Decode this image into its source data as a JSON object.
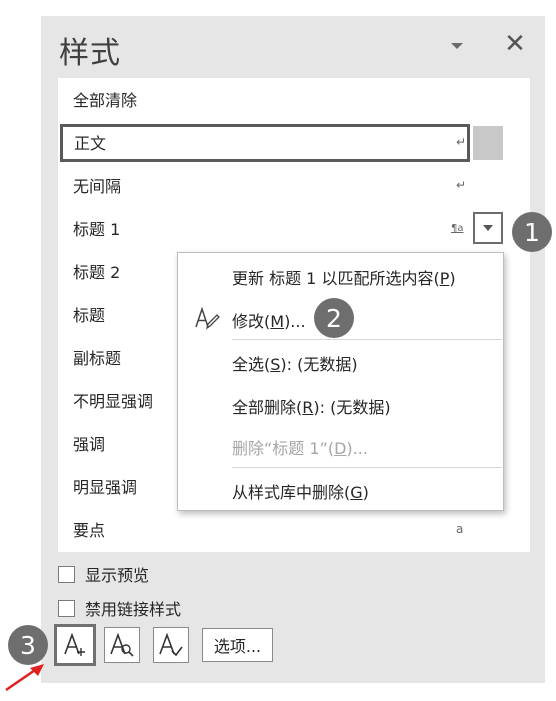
{
  "pane": {
    "title": "样式"
  },
  "styles": [
    {
      "label": "全部清除",
      "marker": ""
    },
    {
      "label": "正文",
      "marker": "↵"
    },
    {
      "label": "无间隔",
      "marker": "↵"
    },
    {
      "label": "标题 1",
      "marker": "¶a"
    },
    {
      "label": "标题 2",
      "marker": ""
    },
    {
      "label": "标题",
      "marker": ""
    },
    {
      "label": "副标题",
      "marker": ""
    },
    {
      "label": "不明显强调",
      "marker": ""
    },
    {
      "label": "强调",
      "marker": ""
    },
    {
      "label": "明显强调",
      "marker": ""
    },
    {
      "label": "要点",
      "marker": "a"
    }
  ],
  "menu": {
    "update": {
      "pre": "更新 标题 1 以匹配所选内容(",
      "key": "P",
      "post": ")"
    },
    "modify": {
      "pre": "修改(",
      "key": "M",
      "post": ")..."
    },
    "select_all": {
      "pre": "全选(",
      "key": "S",
      "post": "): (无数据)"
    },
    "delete_all": {
      "pre": "全部删除(",
      "key": "R",
      "post": "): (无数据)"
    },
    "delete_style": {
      "pre": "删除“标题 1”(",
      "key": "D",
      "post": ")..."
    },
    "remove_gallery": {
      "pre": "从样式库中删除(",
      "key": "G",
      "post": ")"
    }
  },
  "checkboxes": {
    "show_preview": "显示预览",
    "disable_linked": "禁用链接样式"
  },
  "toolbar": {
    "options_label": "选项..."
  },
  "badges": {
    "one": "1",
    "two": "2",
    "three": "3"
  },
  "colors": {
    "badge": "#6e6e6e",
    "arrow": "#e02020",
    "pane_bg": "#e6e6e6"
  }
}
